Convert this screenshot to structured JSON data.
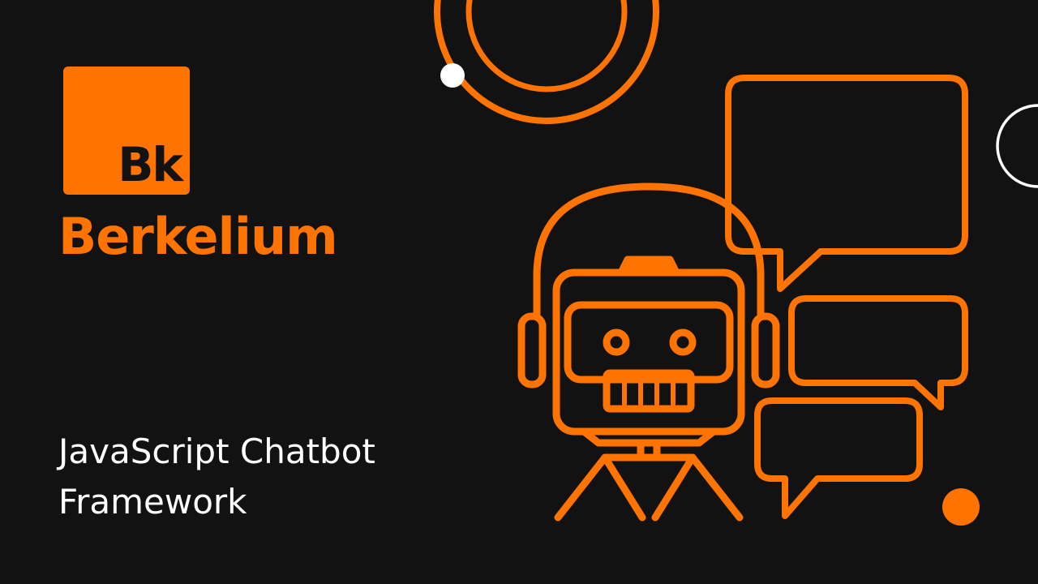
{
  "brand": {
    "logo_text": "Bk",
    "name": "Berkelium"
  },
  "tagline": {
    "line1": "JavaScript Chatbot",
    "line2": "Framework"
  },
  "colors": {
    "background": "#121212",
    "accent": "#FF7300",
    "text": "#FFFFFF"
  },
  "icons": [
    "robot-with-headphones-icon",
    "speech-bubble-icon",
    "ring-icon",
    "dot-icon"
  ]
}
